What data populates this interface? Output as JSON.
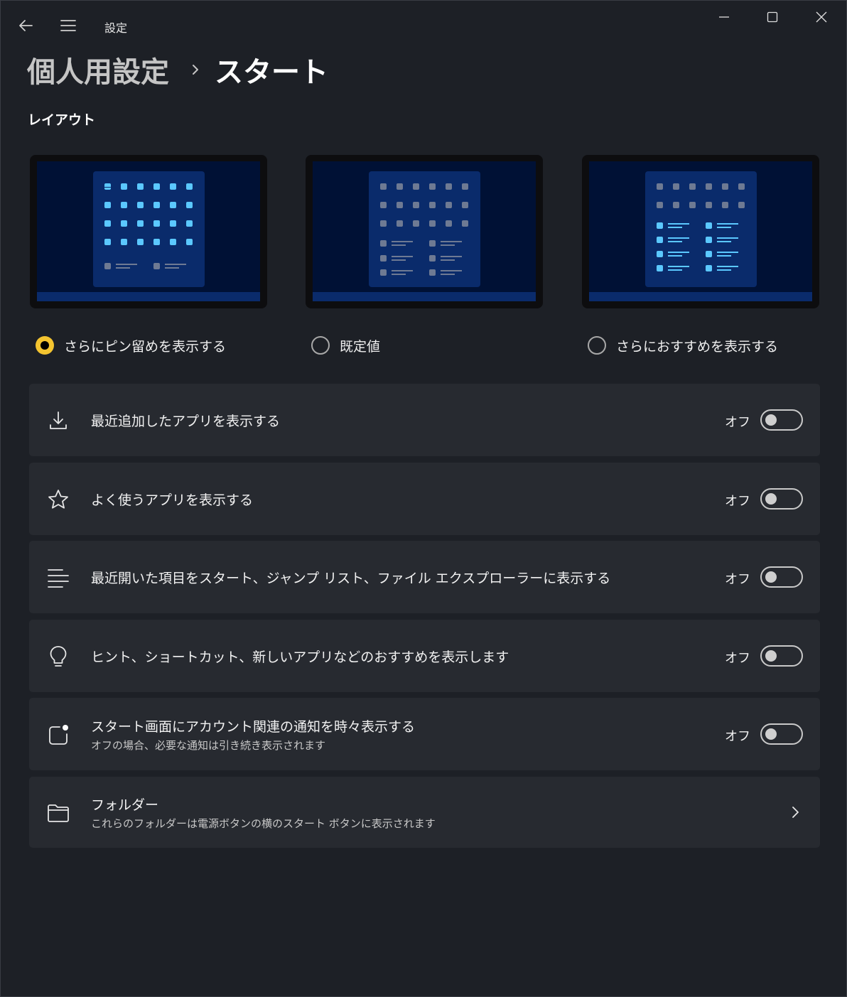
{
  "window": {
    "title": "設定"
  },
  "breadcrumb": {
    "parent": "個人用設定",
    "current": "スタート"
  },
  "layout_section": {
    "title": "レイアウト",
    "options": [
      {
        "label": "さらにピン留めを表示する",
        "selected": true
      },
      {
        "label": "既定値",
        "selected": false
      },
      {
        "label": "さらにおすすめを表示する",
        "selected": false
      }
    ]
  },
  "settings": [
    {
      "icon": "download-icon",
      "title": "最近追加したアプリを表示する",
      "state": "オフ"
    },
    {
      "icon": "star-icon",
      "title": "よく使うアプリを表示する",
      "state": "オフ"
    },
    {
      "icon": "list-icon",
      "title": "最近開いた項目をスタート、ジャンプ リスト、ファイル エクスプローラーに表示する",
      "state": "オフ"
    },
    {
      "icon": "lightbulb-icon",
      "title": "ヒント、ショートカット、新しいアプリなどのおすすめを表示します",
      "state": "オフ"
    },
    {
      "icon": "notification-icon",
      "title": "スタート画面にアカウント関連の通知を時々表示する",
      "subtitle": "オフの場合、必要な通知は引き続き表示されます",
      "state": "オフ"
    },
    {
      "icon": "folder-icon",
      "title": "フォルダー",
      "subtitle": "これらのフォルダーは電源ボタンの横のスタート ボタンに表示されます"
    }
  ],
  "colors": {
    "background": "#1d2026",
    "card": "#272a30",
    "accent": "#f4c430",
    "preview_screen": "#001135",
    "preview_panel": "#0a2b6b",
    "tile_active": "#5bc8ff",
    "tile_inactive": "#6e7a93"
  }
}
